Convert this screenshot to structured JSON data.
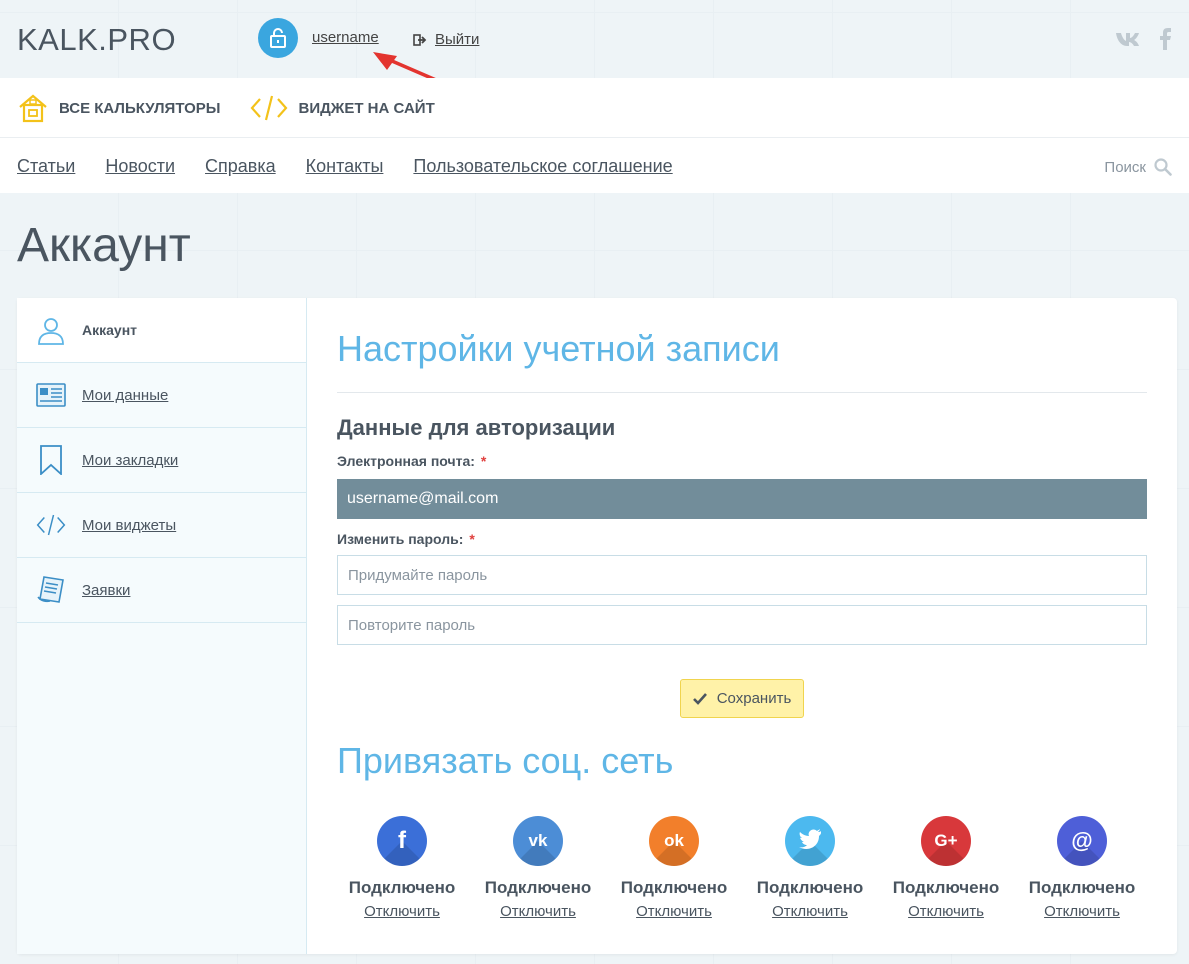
{
  "header": {
    "logo": "KALK.PRO",
    "username": "username",
    "logout_label": "Выйти"
  },
  "categories": [
    {
      "label": "ВСЕ КАЛЬКУЛЯТОРЫ",
      "icon": "house-icon"
    },
    {
      "label": "ВИДЖЕТ НА САЙТ",
      "icon": "code-icon"
    }
  ],
  "nav": [
    "Статьи",
    "Новости",
    "Справка",
    "Контакты",
    "Пользовательское соглашение"
  ],
  "search": {
    "label": "Поиск"
  },
  "page_title": "Аккаунт",
  "sidebar": {
    "items": [
      {
        "label": "Аккаунт",
        "icon": "user-icon",
        "active": true
      },
      {
        "label": "Мои данные",
        "icon": "id-card-icon"
      },
      {
        "label": "Мои закладки",
        "icon": "bookmark-icon"
      },
      {
        "label": "Мои виджеты",
        "icon": "code-icon"
      },
      {
        "label": "Заявки",
        "icon": "document-icon"
      }
    ]
  },
  "settings": {
    "title": "Настройки учетной записи",
    "auth_title": "Данные для авторизации",
    "email_label": "Электронная почта:",
    "email_value": "username@mail.com",
    "password_label": "Изменить пароль:",
    "required_mark": "*",
    "password_placeholder": "Придумайте пароль",
    "password_repeat_placeholder": "Повторите пароль",
    "save_label": "Сохранить"
  },
  "social": {
    "title": "Привязать соц. сеть",
    "networks": [
      {
        "name": "facebook",
        "glyph": "f",
        "color": "#3b6fd8",
        "status": "Подключено",
        "action": "Отключить"
      },
      {
        "name": "vk",
        "glyph": "vk",
        "color": "#4c8dd6",
        "status": "Подключено",
        "action": "Отключить"
      },
      {
        "name": "odnoklassniki",
        "glyph": "ok",
        "color": "#f27f2b",
        "status": "Подключено",
        "action": "Отключить"
      },
      {
        "name": "twitter",
        "glyph": "tw",
        "color": "#4cb9ef",
        "status": "Подключено",
        "action": "Отключить"
      },
      {
        "name": "google-plus",
        "glyph": "G+",
        "color": "#d8383b",
        "status": "Подключено",
        "action": "Отключить"
      },
      {
        "name": "mail",
        "glyph": "@",
        "color": "#4e5fd8",
        "status": "Подключено",
        "action": "Отключить"
      }
    ]
  }
}
